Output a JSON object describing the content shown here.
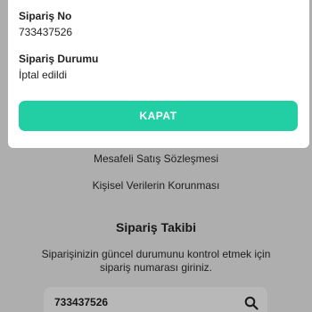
{
  "background": {
    "links": [
      {
        "label": "Mesafeli Satış Sözleşmesi"
      },
      {
        "label": "Kişisel Verilerin Korunması"
      }
    ],
    "tracking": {
      "title": "Sipariş Takibi",
      "description": "Siparişinizin güncel durumunu kontrol etmek için sipariş numarası giriniz.",
      "input_value": "733437526",
      "search_icon": "search-icon"
    }
  },
  "modal": {
    "order_no_label": "Sipariş No",
    "order_no_value": "733437526",
    "status_label": "Sipariş Durumu",
    "status_value": "İptal edildi",
    "close_label": "KAPAT",
    "accent_color": "#22cfa5"
  }
}
